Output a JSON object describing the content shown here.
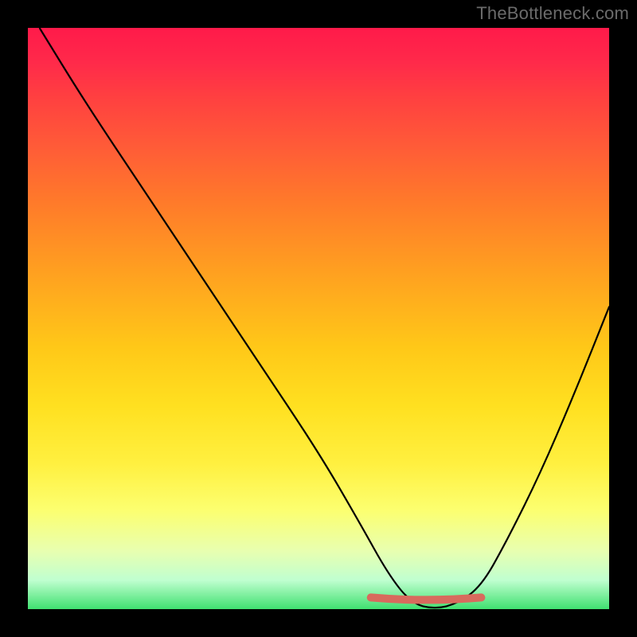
{
  "watermark": "TheBottleneck.com",
  "chart_data": {
    "type": "line",
    "title": "",
    "xlabel": "",
    "ylabel": "",
    "xlim": [
      0,
      100
    ],
    "ylim": [
      0,
      100
    ],
    "grid": false,
    "legend": false,
    "curve": {
      "description": "Bottleneck curve descending sharply from top-left, bottoming out around x≈65–75, rising again toward top-right",
      "x": [
        2,
        10,
        20,
        30,
        40,
        50,
        57,
        62,
        66,
        70,
        74,
        78,
        82,
        88,
        94,
        100
      ],
      "y": [
        100,
        87,
        72,
        57,
        42,
        27,
        15,
        6,
        1,
        0,
        1,
        4,
        11,
        23,
        37,
        52
      ]
    },
    "highlight": {
      "description": "Optimal-range marker at trough",
      "x_range": [
        59,
        78
      ],
      "y": 2,
      "color": "#d86a5d"
    },
    "background_gradient": {
      "stops": [
        {
          "pos": 0.0,
          "color": "#ff1a4a"
        },
        {
          "pos": 0.3,
          "color": "#ff7a2a"
        },
        {
          "pos": 0.55,
          "color": "#ffc818"
        },
        {
          "pos": 0.83,
          "color": "#fcff70"
        },
        {
          "pos": 1.0,
          "color": "#40e070"
        }
      ]
    }
  }
}
